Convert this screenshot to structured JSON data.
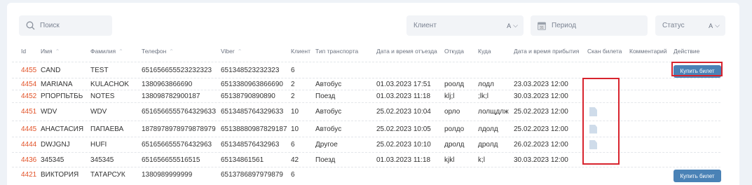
{
  "filters": {
    "search_placeholder": "Поиск",
    "client_label": "Клиент",
    "client_value": "A",
    "period_placeholder": "Период",
    "status_label": "Статус",
    "status_value": "A"
  },
  "columns": [
    "Id",
    "Имя",
    "Фамилия",
    "Телефон",
    "Viber",
    "Клиент",
    "Тип транспорта",
    "Дата и время отъезда",
    "Откуда",
    "Куда",
    "Дата и время прибытия",
    "Скан билета",
    "Комментарий",
    "Действие"
  ],
  "buy_label": "Купить билет",
  "rows": [
    {
      "id": "4455",
      "name": "CAND",
      "surname": "TEST",
      "phone": "651656655523232323",
      "viber": "651348523232323",
      "client": "6",
      "transport": "",
      "depart": "",
      "from": "",
      "to": "",
      "arrive": "",
      "scan": false,
      "buy": true
    },
    {
      "id": "4454",
      "name": "MARIANA",
      "surname": "KULACHOK",
      "phone": "1380963866690",
      "viber": "6513380963866690",
      "client": "2",
      "transport": "Автобус",
      "depart": "01.03.2023 17:51",
      "from": "роолд",
      "to": "лодл",
      "arrive": "23.03.2023 12:00",
      "scan": false,
      "buy": false
    },
    {
      "id": "4452",
      "name": "РПОРПЬТБЬ",
      "surname": "NOTES",
      "phone": "138098782900187",
      "viber": "6513879089089​0",
      "client": "2",
      "transport": "Поезд",
      "depart": "01.03.2023 11:18",
      "from": "klj;l",
      "to": ";lk;l",
      "arrive": "30.03.2023 12:00",
      "scan": false,
      "buy": false
    },
    {
      "id": "4451",
      "name": "WDV",
      "surname": "WDV",
      "phone": "651656655576432963З",
      "viber": "651348576432963З",
      "client": "10",
      "transport": "Автобус",
      "depart": "25.02.2023 10:04",
      "from": "орло",
      "to": "лолщдлж",
      "arrive": "25.02.2023 12:00",
      "scan": true,
      "buy": false
    },
    {
      "id": "4445",
      "name": "АНАСТАСИЯ",
      "surname": "ПАПАЕВА",
      "phone": "1878978978979878979",
      "viber": "65138880987829187",
      "client": "10",
      "transport": "Автобус",
      "depart": "25.02.2023 10:05",
      "from": "ролдо",
      "to": "лдолд",
      "arrive": "25.02.2023 12:00",
      "scan": true,
      "buy": false
    },
    {
      "id": "4444",
      "name": "DWJGNJ",
      "surname": "HUFI",
      "phone": "651656655576432963",
      "viber": "651348576432963",
      "client": "6",
      "transport": "Другое",
      "depart": "25.02.2023 10:10",
      "from": "дролд",
      "to": "дролд",
      "arrive": "26.02.2023 12:00",
      "scan": true,
      "buy": false
    },
    {
      "id": "4436",
      "name": "345345",
      "surname": "345345",
      "phone": "651656655516515",
      "viber": "651348615​61",
      "client": "42",
      "transport": "Поезд",
      "depart": "01.03.2023 11:18",
      "from": "kjkl",
      "to": "k;l",
      "arrive": "30.03.2023 12:00",
      "scan": false,
      "buy": false
    },
    {
      "id": "4421",
      "name": "ВИКТОРИЯ",
      "surname": "ТАТАРСУК",
      "phone": "1380989999999",
      "viber": "651378689797987​9",
      "client": "6",
      "transport": "",
      "depart": "",
      "from": "",
      "to": "",
      "arrive": "",
      "scan": false,
      "buy": true
    }
  ]
}
